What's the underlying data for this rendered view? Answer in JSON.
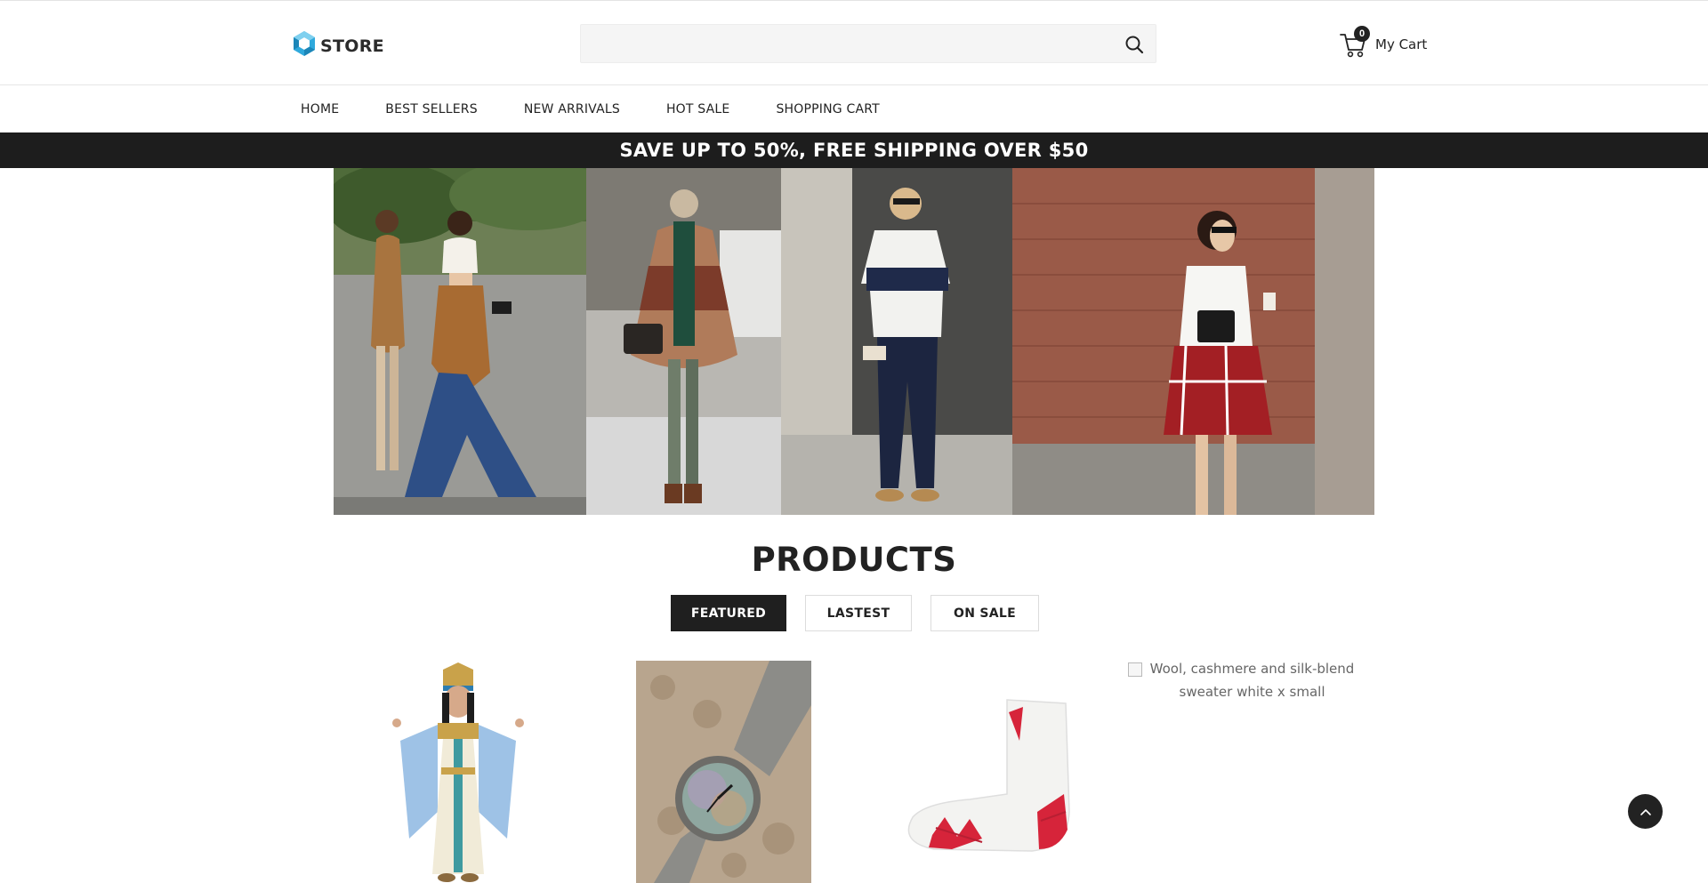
{
  "header": {
    "logo_text": "STORE",
    "search_placeholder": "",
    "search_icon": "search-icon",
    "cart": {
      "count": "0",
      "label": "My Cart",
      "icon": "cart-icon"
    }
  },
  "nav": {
    "items": [
      "HOME",
      "BEST SELLERS",
      "NEW ARRIVALS",
      "HOT SALE",
      "SHOPPING CART"
    ]
  },
  "promo": {
    "text": "SAVE UP TO 50%, FREE SHIPPING OVER $50"
  },
  "products": {
    "title": "PRODUCTS",
    "tabs": [
      "FEATURED",
      "LASTEST",
      "ON SALE"
    ],
    "active_tab": "FEATURED",
    "items": [
      {
        "alt": ""
      },
      {
        "alt": ""
      },
      {
        "alt": ""
      },
      {
        "alt": "Wool, cashmere and silk-blend sweater white x small"
      }
    ]
  },
  "colors": {
    "promo_bg": "#1d1d1d",
    "logo_accent": "#2fa9dc",
    "active_tab_bg": "#1f1f1f"
  },
  "back_to_top_icon": "chevron-up-icon"
}
